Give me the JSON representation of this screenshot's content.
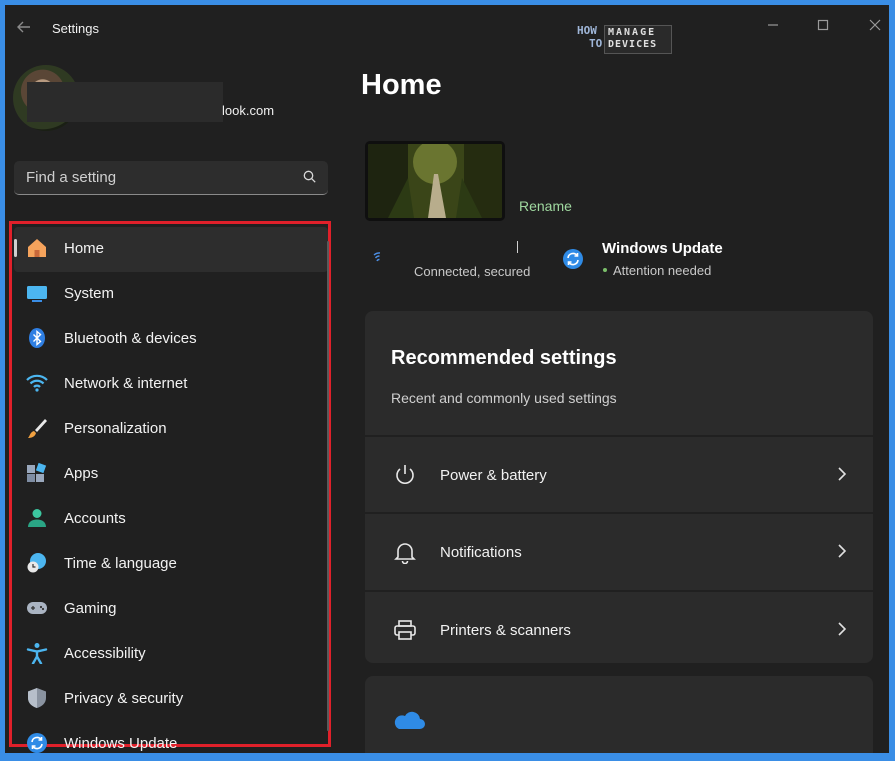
{
  "window": {
    "title": "Settings",
    "controls": {
      "minimize": "—",
      "maximize": "☐",
      "close": "✕"
    }
  },
  "logo": {
    "how": "HOW",
    "to": "TO",
    "manage": "MANAGE",
    "devices": "DEVICES"
  },
  "account": {
    "email_suffix": "look.com"
  },
  "search": {
    "placeholder": "Find a setting"
  },
  "sidebar": {
    "items": [
      {
        "label": "Home",
        "icon": "home-icon",
        "active": true
      },
      {
        "label": "System",
        "icon": "system-icon"
      },
      {
        "label": "Bluetooth & devices",
        "icon": "bluetooth-icon"
      },
      {
        "label": "Network & internet",
        "icon": "wifi-icon"
      },
      {
        "label": "Personalization",
        "icon": "brush-icon"
      },
      {
        "label": "Apps",
        "icon": "apps-icon"
      },
      {
        "label": "Accounts",
        "icon": "accounts-icon"
      },
      {
        "label": "Time & language",
        "icon": "time-language-icon"
      },
      {
        "label": "Gaming",
        "icon": "gamepad-icon"
      },
      {
        "label": "Accessibility",
        "icon": "accessibility-icon"
      },
      {
        "label": "Privacy & security",
        "icon": "shield-icon"
      },
      {
        "label": "Windows Update",
        "icon": "update-icon"
      }
    ]
  },
  "main": {
    "title": "Home",
    "rename_label": "Rename",
    "network": {
      "status": "Connected, secured"
    },
    "windows_update": {
      "title": "Windows Update",
      "status": "Attention needed"
    },
    "recommended": {
      "title": "Recommended settings",
      "subtitle": "Recent and commonly used settings",
      "rows": [
        {
          "label": "Power & battery",
          "icon": "power-icon"
        },
        {
          "label": "Notifications",
          "icon": "bell-icon"
        },
        {
          "label": "Printers & scanners",
          "icon": "printer-icon"
        }
      ]
    },
    "next_card": {
      "icon": "onedrive-cloud-icon"
    }
  },
  "colors": {
    "accent": "#3a8ee6",
    "highlight_frame": "#e0202a",
    "background": "#202020",
    "card": "#2b2b2b"
  }
}
